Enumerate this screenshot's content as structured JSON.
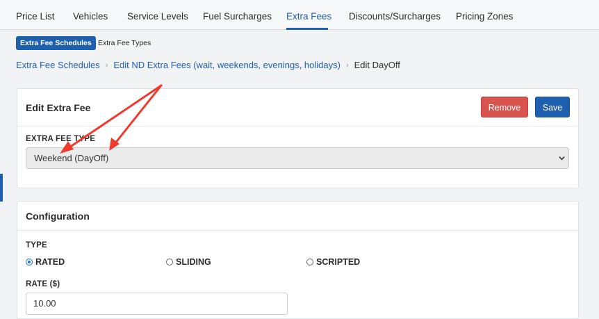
{
  "top_tabs": [
    {
      "label": "Price List"
    },
    {
      "label": "Vehicles"
    },
    {
      "label": "Service Levels"
    },
    {
      "label": "Fuel Surcharges"
    },
    {
      "label": "Extra Fees",
      "active": true
    },
    {
      "label": "Discounts/Surcharges"
    },
    {
      "label": "Pricing Zones"
    }
  ],
  "sub_tabs": {
    "active": "Extra Fee Schedules",
    "other": "Extra Fee Types"
  },
  "breadcrumb": {
    "items": [
      "Extra Fee Schedules",
      "Edit ND Extra Fees (wait, weekends, evenings, holidays)"
    ],
    "current": "Edit DayOff"
  },
  "edit_panel": {
    "title": "Edit Extra Fee",
    "remove_label": "Remove",
    "save_label": "Save",
    "fee_type_label": "EXTRA FEE TYPE",
    "fee_type_value": "Weekend (DayOff)"
  },
  "config_panel": {
    "title": "Configuration",
    "type_label": "TYPE",
    "type_options": [
      {
        "label": "RATED",
        "checked": true
      },
      {
        "label": "SLIDING",
        "checked": false
      },
      {
        "label": "SCRIPTED",
        "checked": false
      }
    ],
    "rate_label": "RATE ($)",
    "rate_value": "10.00"
  },
  "colors": {
    "accent": "#1f5fb0",
    "danger": "#d9534f",
    "annotation_arrow": "#f03a2e"
  }
}
